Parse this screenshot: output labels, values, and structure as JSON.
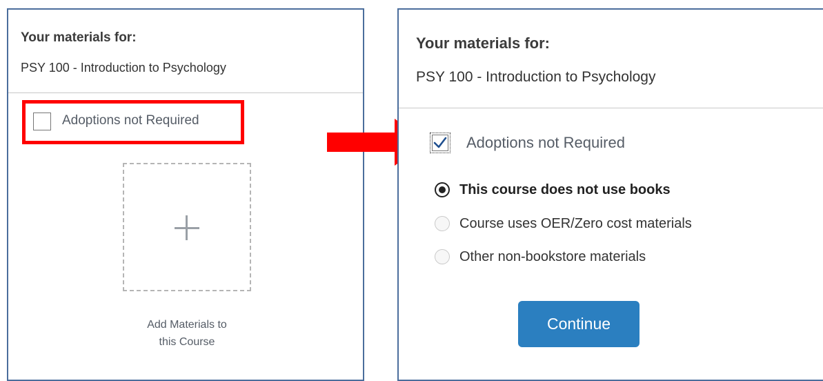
{
  "left_panel": {
    "title": "Your materials for:",
    "course": "PSY 100 - Introduction to Psychology",
    "checkbox_label": "Adoptions not Required",
    "checkbox_checked": false,
    "add_materials_line1": "Add Materials to",
    "add_materials_line2": "this Course"
  },
  "right_panel": {
    "title": "Your materials for:",
    "course": "PSY 100 - Introduction to Psychology",
    "checkbox_label": "Adoptions not Required",
    "checkbox_checked": true,
    "options": [
      {
        "label": "This course does not use books",
        "selected": true
      },
      {
        "label": "Course uses OER/Zero cost materials",
        "selected": false
      },
      {
        "label": "Other non-bookstore materials",
        "selected": false
      }
    ],
    "continue_label": "Continue"
  },
  "colors": {
    "highlight": "#ff0000",
    "arrow": "#ff0000",
    "panel_border": "#4a6d9c",
    "button": "#2b7fc0"
  }
}
